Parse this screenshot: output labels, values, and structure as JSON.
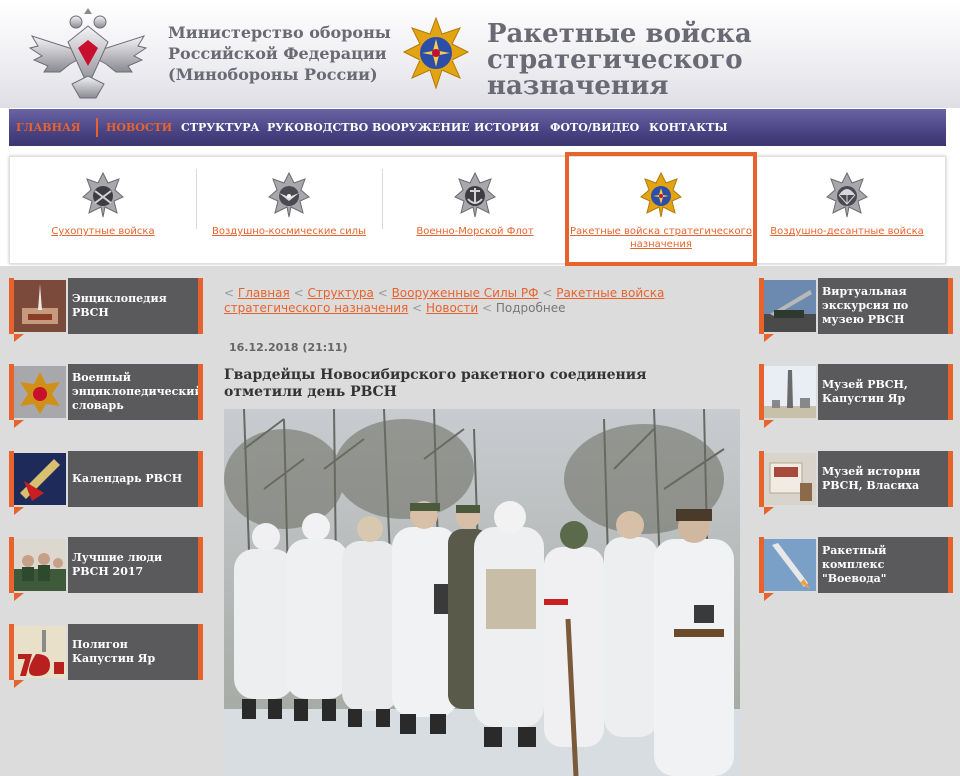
{
  "header": {
    "ministry_lines": [
      "Министерство обороны",
      "Российской Федерации",
      "(Минобороны России)"
    ],
    "branch_lines": [
      "Ракетные войска",
      "стратегического",
      "назначения"
    ]
  },
  "nav": {
    "items": [
      {
        "label": "ГЛАВНАЯ"
      },
      {
        "label": "НОВОСТИ"
      },
      {
        "label": "СТРУКТУРА"
      },
      {
        "label": "РУКОВОДСТВО"
      },
      {
        "label": "ВООРУЖЕНИЕ"
      },
      {
        "label": "ИСТОРИЯ"
      },
      {
        "label": "ФОТО/ВИДЕО"
      },
      {
        "label": "КОНТАКТЫ"
      }
    ]
  },
  "branches": [
    {
      "label": "Сухопутные войска",
      "icon": "ground-forces-emblem-icon"
    },
    {
      "label": "Воздушно-космические силы",
      "icon": "aerospace-forces-emblem-icon"
    },
    {
      "label": "Военно-Морской Флот",
      "icon": "navy-emblem-icon"
    },
    {
      "label": "Ракетные войска стратегического назначения",
      "icon": "rvsn-emblem-icon",
      "selected": true
    },
    {
      "label": "Воздушно-десантные войска",
      "icon": "airborne-forces-emblem-icon"
    }
  ],
  "left_tiles": [
    {
      "label": "Энциклопедия РВСН",
      "icon": "encyclopedia-thumbnail"
    },
    {
      "label": "Военный энциклопедический словарь",
      "icon": "dictionary-thumbnail"
    },
    {
      "label": "Календарь РВСН",
      "icon": "calendar-thumbnail"
    },
    {
      "label": "Лучшие люди РВСН 2017",
      "icon": "best-people-thumbnail"
    },
    {
      "label": "Полигон Капустин Яр",
      "icon": "kapustin-yar-70-thumbnail"
    }
  ],
  "right_tiles": [
    {
      "label": "Виртуальная экскурсия по музею РВСН",
      "icon": "virtual-tour-thumbnail"
    },
    {
      "label": "Музей РВСН, Капустин Яр",
      "icon": "museum-kapustin-yar-thumbnail"
    },
    {
      "label": "Музей истории РВСН, Власиха",
      "icon": "museum-vlasikha-thumbnail"
    },
    {
      "label": "Ракетный комплекс \"Воевода\"",
      "icon": "voevoda-missile-thumbnail"
    }
  ],
  "breadcrumb": {
    "prefix": "<",
    "links": [
      "Главная",
      "Структура",
      "Вооруженные Силы РФ",
      "Ракетные войска стратегического назначения",
      "Новости"
    ],
    "current": "Подробнее"
  },
  "article": {
    "date": "16.12.2018 (21:11)",
    "title": "Гвардейцы Новосибирского ракетного соединения отметили день РВСН",
    "photo_icon": "soldiers-in-winter-camouflage-photo"
  },
  "colors": {
    "accent": "#e8632c",
    "nav_bg": "#4a4384",
    "tile_bg": "#5a5a5c",
    "content_bg": "#dcdcdc"
  }
}
